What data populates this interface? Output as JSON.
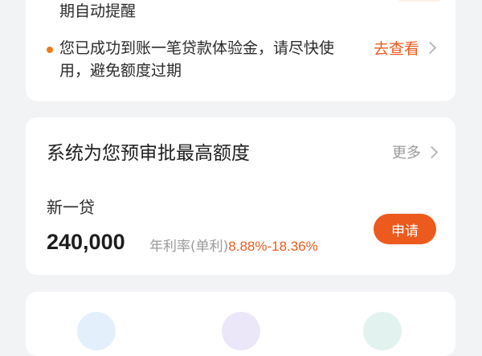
{
  "notice_card": {
    "line_reminder": "期自动提醒",
    "message_line1": "您已成功到账一笔贷款体验金，请尽快使",
    "message_line2": "用，避免额度过期",
    "view_label": "去查看"
  },
  "credit_card": {
    "title": "系统为您预审批最高额度",
    "more_label": "更多",
    "product_name": "新一贷",
    "amount": "240,000",
    "rate_label": "年利率(单利)",
    "rate_value": "8.88%-18.36%",
    "apply_label": "申请"
  },
  "colors": {
    "accent": "#ec5a1d",
    "dot": "#f07a1b",
    "background": "#f2f3f5"
  },
  "icons": [
    "chevron-right-icon",
    "bullet-dot-icon"
  ]
}
